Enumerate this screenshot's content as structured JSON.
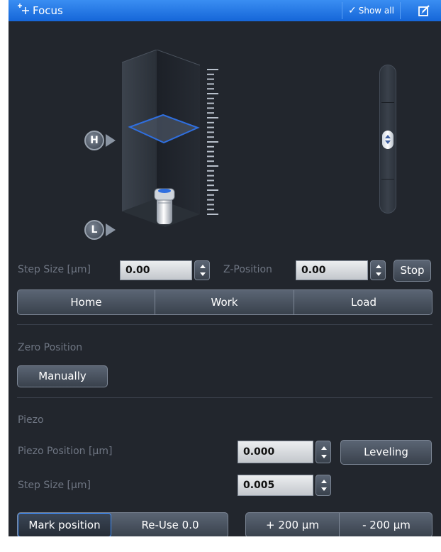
{
  "titlebar": {
    "title": "Focus",
    "icon": "crosshair-plus-icon",
    "show_all_label": "Show all",
    "show_all_icon": "checkmark-icon",
    "edit_icon": "edit-icon",
    "accent_color": "#1f78e6"
  },
  "focus_visual": {
    "high_marker": "H",
    "low_marker": "L",
    "objective_icon": "objective-icon",
    "plane_color": "#2f6fe0"
  },
  "stage_slider": {
    "icon": "drag-handle-icon",
    "level": 0.48
  },
  "controls": {
    "step_size_label": "Step Size [µm]",
    "step_size_value": "0.00",
    "z_position_label": "Z-Position",
    "z_position_value": "0.00",
    "stop_label": "Stop",
    "positions": [
      "Home",
      "Work",
      "Load"
    ]
  },
  "zero_position": {
    "heading": "Zero Position",
    "manually_label": "Manually"
  },
  "piezo": {
    "heading": "Piezo",
    "position_label": "Piezo Position [µm]",
    "position_value": "0.000",
    "leveling_label": "Leveling",
    "step_label": "Step Size [µm]",
    "step_value": "0.005"
  },
  "bottom": {
    "mark_position_label": "Mark position",
    "reuse_label": "Re-Use 0.0",
    "plus_label": "+ 200 µm",
    "minus_label": "- 200 µm"
  }
}
